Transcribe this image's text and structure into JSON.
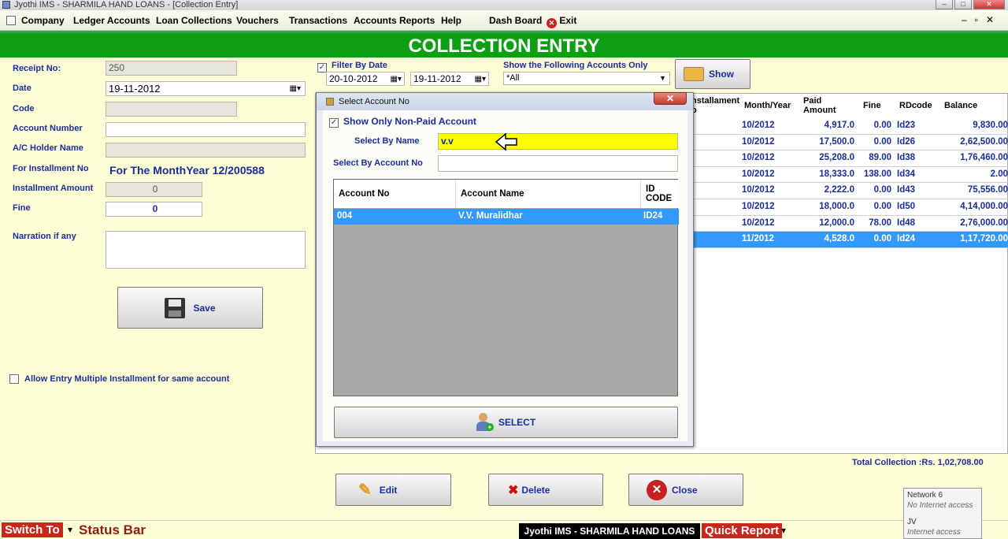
{
  "window": {
    "title": "Jyothi IMS - SHARMILA HAND LOANS - [Collection Entry]"
  },
  "menu": [
    "Company",
    "Ledger Accounts",
    "Loan Collections",
    "Vouchers",
    "Transactions",
    "Accounts Reports",
    "Help",
    "Dash Board",
    "Exit"
  ],
  "banner": "COLLECTION ENTRY",
  "form": {
    "receipt_label": "Receipt No:",
    "receipt_value": "250",
    "date_label": "Date",
    "date_value": "19-11-2012",
    "code_label": "Code",
    "code_value": "",
    "acc_label": "Account Number",
    "acc_value": "",
    "holder_label": "A/C Holder Name",
    "holder_value": "",
    "inst_label": "For Installment No",
    "inst_value": "For The MonthYear 12/200588",
    "amount_label": "Installment Amount",
    "amount_value": "0",
    "fine_label": "Fine",
    "fine_value": "0",
    "narr_label": "Narration if any",
    "save": "Save",
    "multi": "Allow Entry Multiple Installment for same account"
  },
  "filter": {
    "by_date": "Filter By Date",
    "from": "20-10-2012",
    "to": "19-11-2012",
    "accounts_label": "Show the Following Accounts Only",
    "accounts_value": "*All",
    "show": "Show"
  },
  "grid": {
    "headers": {
      "inst": "nstallament\no",
      "month": "Month/Year",
      "paid": "Paid\nAmount",
      "fine": "Fine",
      "rd": "RDcode",
      "bal": "Balance"
    },
    "rows": [
      {
        "inst": "",
        "month": "10/2012",
        "paid": "4,917.0",
        "fine": "0.00",
        "rd": "Id23",
        "bal": "9,830.00"
      },
      {
        "inst": "",
        "month": "10/2012",
        "paid": "17,500.0",
        "fine": "0.00",
        "rd": "Id26",
        "bal": "2,62,500.00"
      },
      {
        "inst": "",
        "month": "10/2012",
        "paid": "25,208.0",
        "fine": "89.00",
        "rd": "Id38",
        "bal": "1,76,460.00"
      },
      {
        "inst": "",
        "month": "10/2012",
        "paid": "18,333.0",
        "fine": "138.00",
        "rd": "Id34",
        "bal": "2.00"
      },
      {
        "inst": "",
        "month": "10/2012",
        "paid": "2,222.0",
        "fine": "0.00",
        "rd": "Id43",
        "bal": "75,556.00"
      },
      {
        "inst": "",
        "month": "10/2012",
        "paid": "18,000.0",
        "fine": "0.00",
        "rd": "Id50",
        "bal": "4,14,000.00"
      },
      {
        "inst": "",
        "month": "10/2012",
        "paid": "12,000.0",
        "fine": "78.00",
        "rd": "Id48",
        "bal": "2,76,000.00"
      },
      {
        "inst": "",
        "month": "11/2012",
        "paid": "4,528.0",
        "fine": "0.00",
        "rd": "Id24",
        "bal": "1,17,720.00"
      }
    ],
    "total": "Total Collection :Rs. 1,02,708.00"
  },
  "actions": {
    "edit": "Edit",
    "delete": "Delete",
    "close": "Close"
  },
  "dialog": {
    "title": "Select Account No",
    "nonpaid": "Show Only Non-Paid Account",
    "by_name_label": "Select By Name",
    "by_name_value": "v.v",
    "by_acc_label": "Select By Account No",
    "by_acc_value": "",
    "cols": {
      "acc": "Account No",
      "name": "Account Name",
      "id": "ID\nCODE"
    },
    "row": {
      "acc": "004",
      "name": "V.V. Muralidhar",
      "id": "ID24"
    },
    "select": "SELECT"
  },
  "status": {
    "switch": "Switch To",
    "bar": "Status Bar",
    "app": "Jyothi IMS - SHARMILA HAND LOANS",
    "quick": "Quick Report"
  },
  "tray": {
    "net1": "Network  6",
    "net1sub": "No Internet access",
    "net2": "JV",
    "net2sub": "Internet access"
  }
}
